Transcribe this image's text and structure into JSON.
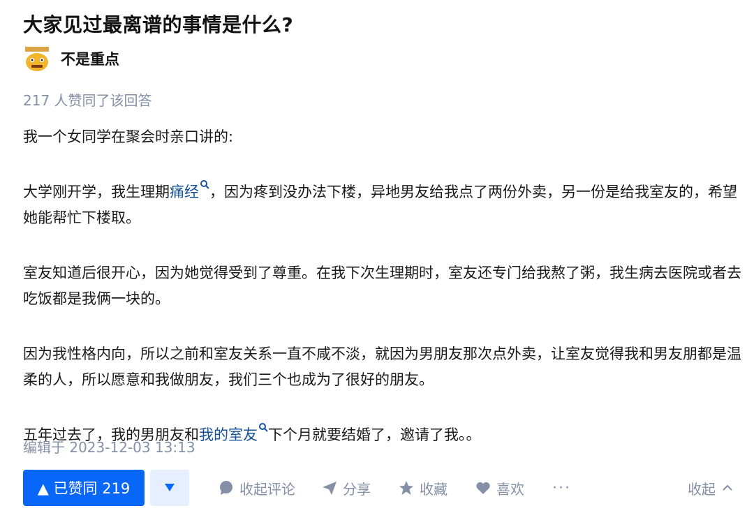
{
  "question": {
    "title": "大家见过最离谱的事情是什么?"
  },
  "author": {
    "name": "不是重点",
    "avatar_icon": "smiley-face-avatar"
  },
  "answer": {
    "votes_text": "217 人赞同了该回答",
    "paragraphs": {
      "p1": "我一个女同学在聚会时亲口讲的:",
      "p2_a": "大学刚开学，我生理期",
      "p2_kw": "痛经",
      "p2_b": "，因为疼到没办法下楼，异地男友给我点了两份外卖，另一份是给我室友的，希望她能帮忙下楼取。",
      "p3": "室友知道后很开心，因为她觉得受到了尊重。在我下次生理期时，室友还专门给我熬了粥，我生病去医院或者去吃饭都是我俩一块的。",
      "p4": "因为我性格内向，所以之前和室友关系一直不咸不淡，就因为男朋友那次点外卖，让室友觉得我和男友朋都是温柔的人，所以愿意和我做朋友，我们三个也成为了很好的朋友。",
      "p5_a": "五年过去了，我的男朋友和",
      "p5_kw": "我的室友",
      "p5_b": "下个月就要结婚了，邀请了我。。"
    },
    "edit_time": "编辑于 2023-12-03 13:13"
  },
  "actions": {
    "upvote_label": "▲ 已赞同 219",
    "downvote_icon": "triangle-down-icon",
    "comment_label": "收起评论",
    "share_label": "分享",
    "favorite_label": "收藏",
    "like_label": "喜欢",
    "more_label": "···",
    "collapse_label": "收起"
  },
  "colors": {
    "primary": "#0866f8",
    "keyword_link": "#175199",
    "meta_gray": "#8590a6",
    "downvote_bg": "#e6efff"
  }
}
